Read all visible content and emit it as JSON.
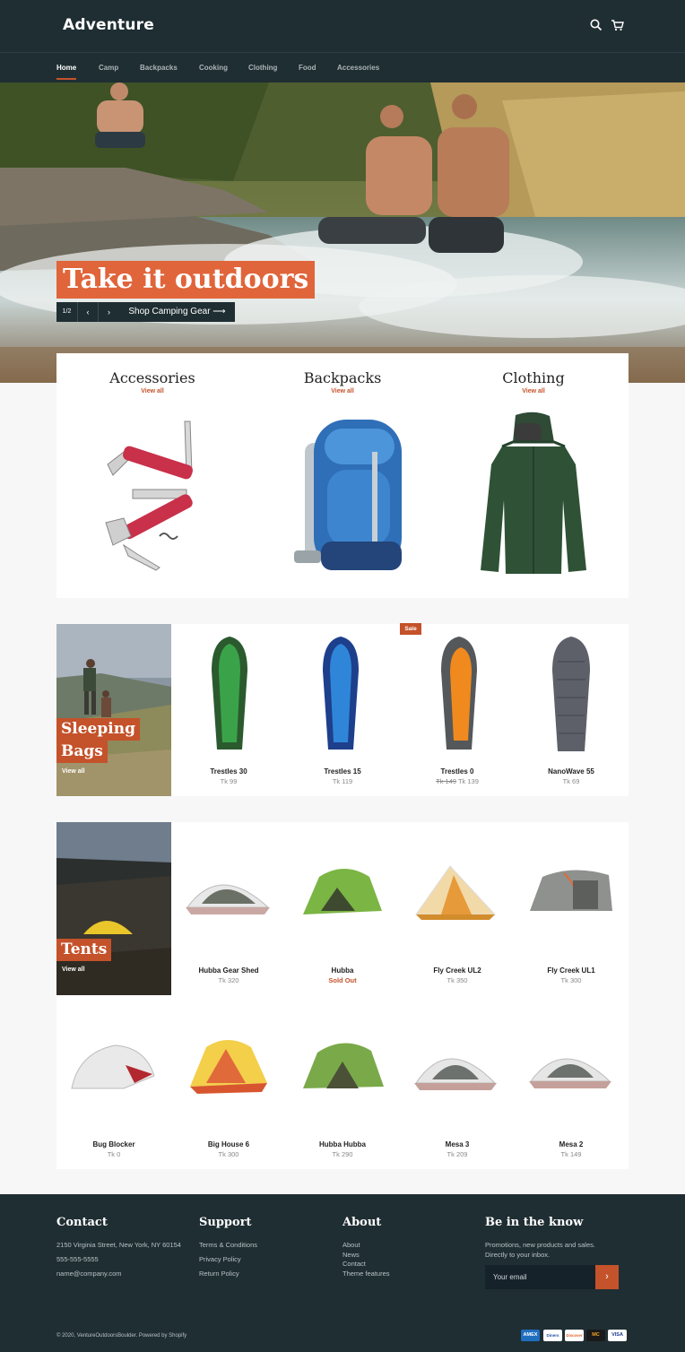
{
  "header": {
    "logo": "Adventure"
  },
  "nav": {
    "items": [
      "Home",
      "Camp",
      "Backpacks",
      "Cooking",
      "Clothing",
      "Food",
      "Accessories"
    ]
  },
  "hero": {
    "title": "Take it outdoors",
    "counter": "1/2",
    "prev": "‹",
    "next": "›",
    "cta": "Shop Camping Gear ⟶"
  },
  "collections": [
    {
      "title": "Accessories",
      "link": "View all"
    },
    {
      "title": "Backpacks",
      "link": "View all"
    },
    {
      "title": "Clothing",
      "link": "View all"
    }
  ],
  "sleeping": {
    "title_line1": "Sleeping",
    "title_line2": "Bags",
    "link": "View all",
    "sale_badge": "Sale",
    "products": [
      {
        "name": "Trestles 30",
        "price": "Tk 99"
      },
      {
        "name": "Trestles 15",
        "price": "Tk 119"
      },
      {
        "name": "Trestles 0",
        "old_price": "Tk 149",
        "price": "Tk 139"
      },
      {
        "name": "NanoWave 55",
        "price": "Tk 69"
      }
    ]
  },
  "tents": {
    "title": "Tents",
    "link": "View all",
    "products": [
      {
        "name": "Hubba Gear Shed",
        "price": "Tk 320"
      },
      {
        "name": "Hubba",
        "price": "Sold Out"
      },
      {
        "name": "Fly Creek UL2",
        "price": "Tk 350"
      },
      {
        "name": "Fly Creek UL1",
        "price": "Tk 300"
      },
      {
        "name": "Bug Blocker",
        "price": "Tk 0"
      },
      {
        "name": "Big House 6",
        "price": "Tk 300"
      },
      {
        "name": "Hubba Hubba",
        "price": "Tk 290"
      },
      {
        "name": "Mesa 3",
        "price": "Tk 209"
      },
      {
        "name": "Mesa 2",
        "price": "Tk 149"
      }
    ]
  },
  "footer": {
    "contact": {
      "title": "Contact",
      "address": "2150 Virginia Street, New York, NY 60154",
      "phone": "555-555-5555",
      "email": "name@company.com"
    },
    "support": {
      "title": "Support",
      "links": [
        "Terms & Conditions",
        "Privacy Policy",
        "Return Policy"
      ]
    },
    "about": {
      "title": "About",
      "links": [
        "About",
        "News",
        "Contact",
        "Theme features"
      ]
    },
    "newsletter": {
      "title": "Be in the know",
      "line1": "Promotions, new products and sales.",
      "line2": "Directly to your inbox.",
      "placeholder": "Your email",
      "submit": "›"
    },
    "copyright": "© 2020, VentureOutdoorsBoulder. Powered by Shopify",
    "payments": [
      "AMEX",
      "Diners",
      "Discover",
      "MC",
      "VISA"
    ]
  },
  "colors": {
    "dark": "#1f2e33",
    "accent": "#c4522a",
    "hero_label": "#e0653a"
  }
}
